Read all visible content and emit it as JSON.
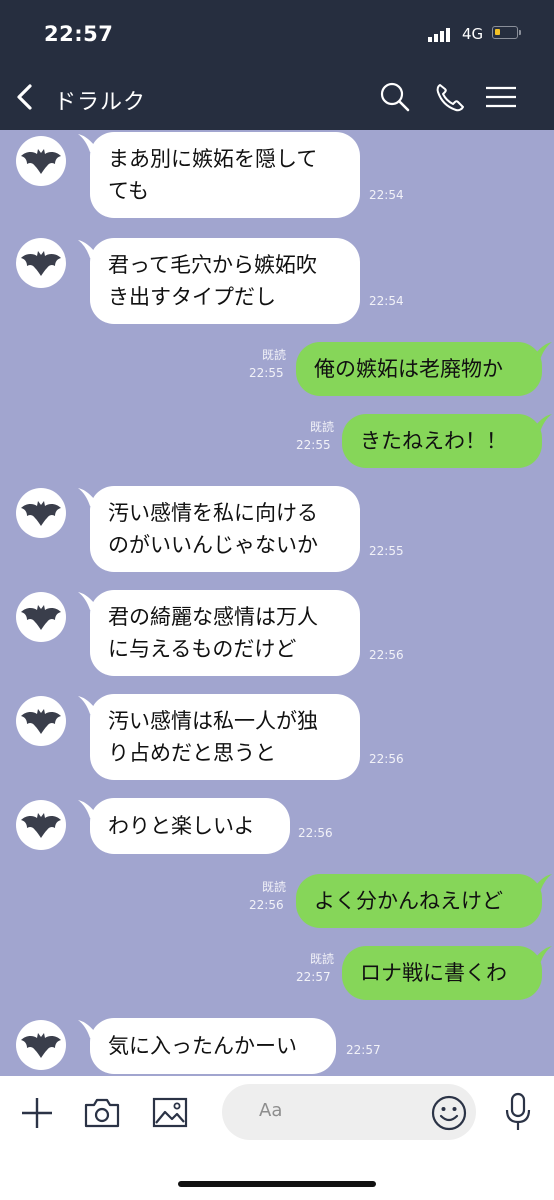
{
  "status": {
    "time": "22:57",
    "network": "4G"
  },
  "header": {
    "title": "ドラルク",
    "icons": [
      "back-icon",
      "search-icon",
      "phone-icon",
      "menu-icon"
    ]
  },
  "messages": [
    {
      "side": "in",
      "text": "まあ別に嫉妬を隠して\nても",
      "time": "22:54"
    },
    {
      "side": "in",
      "text": "君って毛穴から嫉妬吹\nき出すタイプだし",
      "time": "22:54"
    },
    {
      "side": "out",
      "text": "俺の嫉妬は老廃物か",
      "read": "既読",
      "time": "22:55"
    },
    {
      "side": "out",
      "text": "きたねえわ！！",
      "read": "既読",
      "time": "22:55"
    },
    {
      "side": "in",
      "text": "汚い感情を私に向ける\nのがいいんじゃないか",
      "time": "22:55"
    },
    {
      "side": "in",
      "text": "君の綺麗な感情は万人\nに与えるものだけど",
      "time": "22:56"
    },
    {
      "side": "in",
      "text": "汚い感情は私一人が独\nり占めだと思うと",
      "time": "22:56"
    },
    {
      "side": "in",
      "text": "わりと楽しいよ",
      "time": "22:56"
    },
    {
      "side": "out",
      "text": "よく分かんねえけど",
      "read": "既読",
      "time": "22:56"
    },
    {
      "side": "out",
      "text": "ロナ戦に書くわ",
      "read": "既読",
      "time": "22:57"
    },
    {
      "side": "in",
      "text": "気に入ったんかーい",
      "time": "22:57"
    }
  ],
  "input": {
    "placeholder": "Aa"
  },
  "colors": {
    "header": "#262e3f",
    "chat_bg": "#a1a5cf",
    "out_bubble": "#86d659",
    "in_bubble": "#ffffff"
  }
}
